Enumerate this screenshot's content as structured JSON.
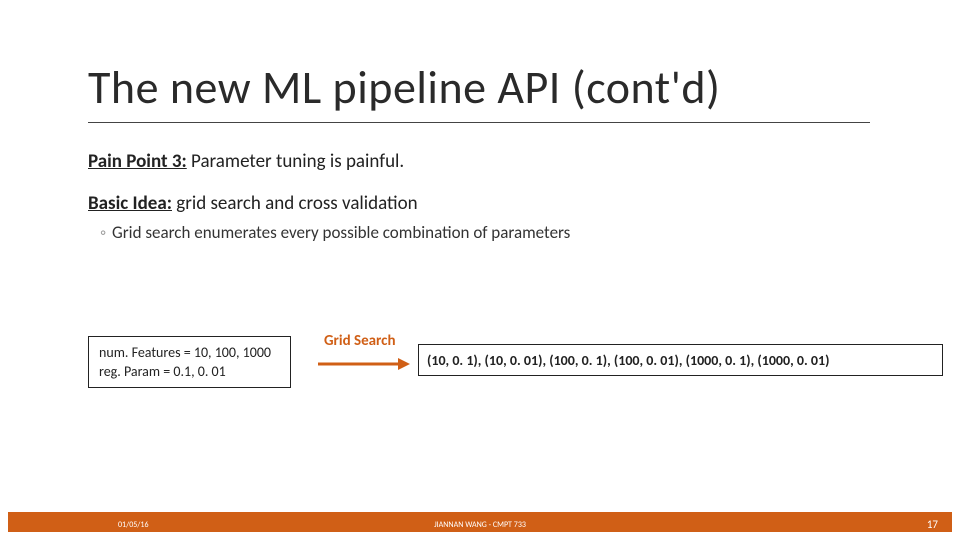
{
  "title": "The new ML pipeline API  (cont'd)",
  "pain_label": "Pain Point 3:",
  "pain_text": " Parameter tuning is painful.",
  "idea_label": "Basic Idea:",
  "idea_text": " grid search and cross validation",
  "bullet_mark": "◦",
  "bullet_text": "Grid search enumerates every possible combination of parameters",
  "params_line1": "num. Features = 10, 100, 1000",
  "params_line2": "reg. Param = 0.1, 0. 01",
  "arrow_label": "Grid Search",
  "arrow_color": "#d05f16",
  "result_text": "(10, 0. 1), (10, 0. 01), (100, 0. 1), (100, 0. 01), (1000, 0. 1), (1000, 0. 01)",
  "footer_date": "01/05/16",
  "footer_center": "JIANNAN WANG - CMPT 733",
  "footer_page": "17"
}
